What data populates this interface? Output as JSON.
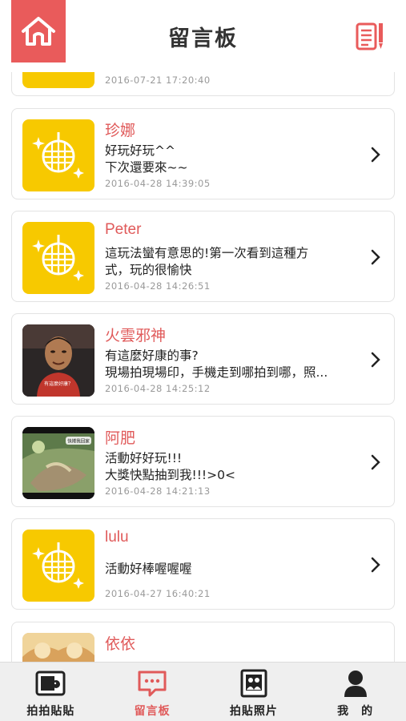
{
  "header": {
    "title": "留言板",
    "home_icon": "home-icon",
    "compose_icon": "write-note-icon",
    "accent": "#e95b5b"
  },
  "partial_top": {
    "time": "2016-07-21 17:20:40"
  },
  "messages": [
    {
      "name": "珍娜",
      "text": "好玩好玩^^\n下次還要來~~",
      "time": "2016-04-28 14:39:05",
      "avatar": "default-yellow"
    },
    {
      "name": "Peter",
      "text": "這玩法蠻有意思的!第一次看到這種方\n式，玩的很愉快",
      "time": "2016-04-28 14:26:51",
      "avatar": "default-yellow"
    },
    {
      "name": "火雲邪神",
      "text": "有這麼好康的事?\n現場拍現場印，手機走到哪拍到哪，照...",
      "time": "2016-04-28 14:25:12",
      "avatar": "photo-man"
    },
    {
      "name": "阿肥",
      "text": "活動好好玩!!!\n大獎快點抽到我!!!>0<",
      "time": "2016-04-28 14:21:13",
      "avatar": "photo-cat"
    },
    {
      "name": "lulu",
      "text": "活動好棒喔喔喔",
      "time": "2016-04-27 16:40:21",
      "avatar": "default-yellow"
    },
    {
      "name": "依依",
      "text": "",
      "time": "",
      "avatar": "photo-partial"
    }
  ],
  "avatar_captions": {
    "photo-man": "有這麼好康？",
    "photo-cat": "快捲我回家"
  },
  "tabs": [
    {
      "label": "拍拍貼貼",
      "icon": "photo-sticker-icon"
    },
    {
      "label": "留言板",
      "icon": "message-board-icon",
      "active": true
    },
    {
      "label": "拍貼照片",
      "icon": "photo-album-icon"
    },
    {
      "label": "我　的",
      "icon": "user-profile-icon"
    }
  ]
}
